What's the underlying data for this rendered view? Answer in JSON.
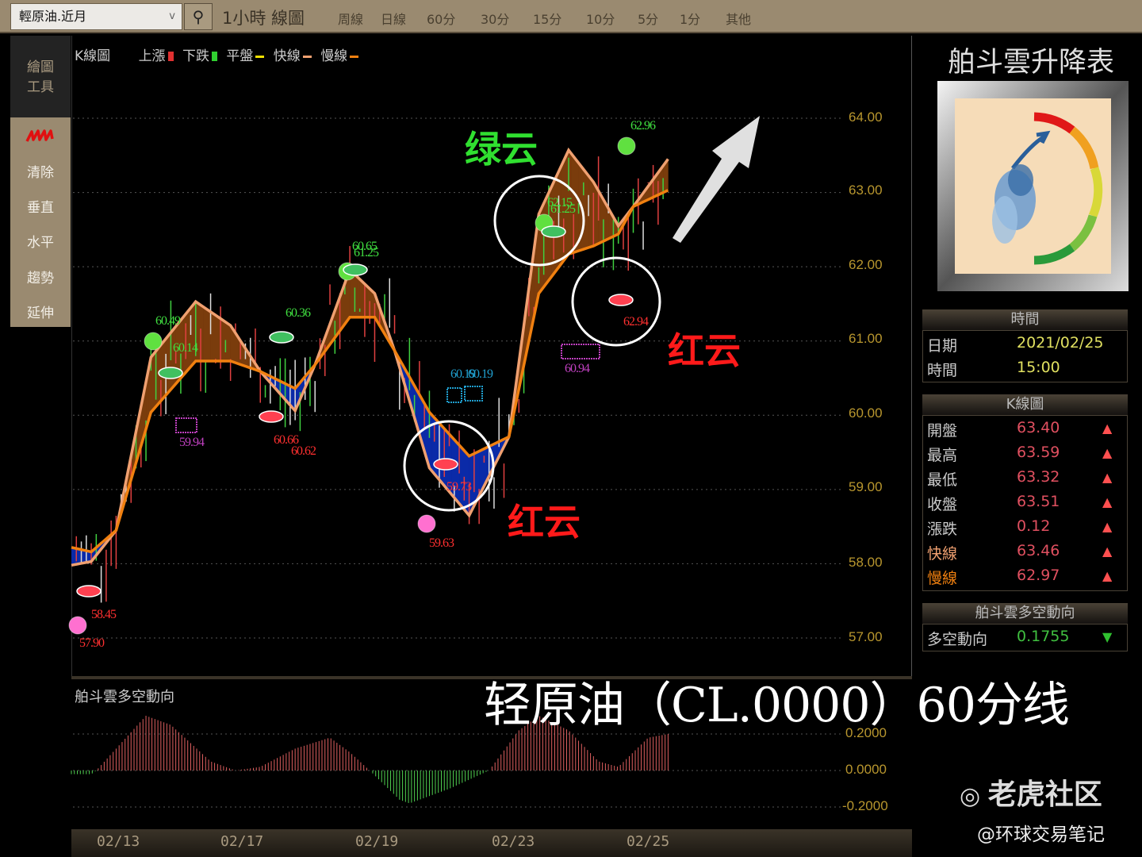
{
  "toolbar": {
    "symbol": "輕原油.近月",
    "chart_type": "1小時 線圖",
    "periods": [
      "周線",
      "日線",
      "60分",
      "30分",
      "15分",
      "10分",
      "5分",
      "1分",
      "其他"
    ]
  },
  "sidebar": {
    "header": [
      "繪圖",
      "工具"
    ],
    "tools": [
      "清除",
      "垂直",
      "水平",
      "趨勢",
      "延伸"
    ],
    "pen_icon": "scribble-icon"
  },
  "legend": {
    "title": "K線圖",
    "items": [
      {
        "label": "上漲",
        "color": "#e03030"
      },
      {
        "label": "下跌",
        "color": "#30d030"
      },
      {
        "label": "平盤",
        "color": "#f0e000"
      },
      {
        "label": "快線",
        "color": "#f0a070"
      },
      {
        "label": "慢線",
        "color": "#f08010"
      }
    ]
  },
  "indicator": {
    "title": "舶斗雲多空動向"
  },
  "chart_data": [
    {
      "type": "line",
      "title": "K線圖",
      "y_ticks": [
        "64.00",
        "63.00",
        "62.00",
        "61.00",
        "60.00",
        "59.00",
        "58.00",
        "57.00"
      ],
      "ylim": [
        57.0,
        64.0
      ],
      "x_ticks": [
        "02/13",
        "02/17",
        "02/19",
        "02/23",
        "02/25"
      ],
      "grid": true,
      "series": [
        {
          "name": "快線",
          "color": "#f0a070",
          "points": [
            [
              0,
              57.98
            ],
            [
              4,
              58.03
            ],
            [
              9,
              58.45
            ],
            [
              16,
              60.78
            ],
            [
              25,
              61.53
            ],
            [
              32,
              61.21
            ],
            [
              38,
              60.59
            ],
            [
              45,
              60.06
            ],
            [
              49,
              60.68
            ],
            [
              56,
              61.96
            ],
            [
              61,
              61.64
            ],
            [
              65,
              60.87
            ],
            [
              72,
              59.29
            ],
            [
              80,
              58.65
            ],
            [
              88,
              59.71
            ],
            [
              94,
              62.71
            ],
            [
              100,
              63.57
            ],
            [
              105,
              63.14
            ],
            [
              110,
              62.55
            ],
            [
              113,
              62.81
            ],
            [
              120,
              63.45
            ]
          ]
        },
        {
          "name": "慢線",
          "color": "#f08010",
          "points": [
            [
              0,
              58.22
            ],
            [
              4,
              58.16
            ],
            [
              9,
              58.45
            ],
            [
              16,
              60.04
            ],
            [
              25,
              60.73
            ],
            [
              32,
              60.73
            ],
            [
              38,
              60.59
            ],
            [
              45,
              60.36
            ],
            [
              49,
              60.68
            ],
            [
              56,
              61.32
            ],
            [
              61,
              61.32
            ],
            [
              65,
              60.87
            ],
            [
              72,
              60.04
            ],
            [
              80,
              59.45
            ],
            [
              88,
              59.71
            ],
            [
              94,
              61.64
            ],
            [
              100,
              62.17
            ],
            [
              105,
              62.28
            ],
            [
              110,
              62.44
            ],
            [
              113,
              62.81
            ],
            [
              120,
              63.03
            ]
          ]
        }
      ],
      "cloud_colors": {
        "bull": "#7a3c0c",
        "bear": "#0a2aa8"
      },
      "annotations": [
        {
          "text": "57.90",
          "color": "#ff3030"
        },
        {
          "text": "58.45",
          "color": "#ff3030"
        },
        {
          "text": "60.49",
          "color": "#40e040"
        },
        {
          "text": "60.14",
          "color": "#40e040"
        },
        {
          "text": "59.94",
          "color": "#c040c0"
        },
        {
          "text": "60.36",
          "color": "#40e040"
        },
        {
          "text": "60.66",
          "color": "#ff3030"
        },
        {
          "text": "60.62",
          "color": "#ff3030"
        },
        {
          "text": "60.65",
          "color": "#40e040"
        },
        {
          "text": "61.25",
          "color": "#40e040"
        },
        {
          "text": "60.19",
          "color": "#20a0d0"
        },
        {
          "text": "60.19",
          "color": "#20a0d0"
        },
        {
          "text": "59.73",
          "color": "#ff3030"
        },
        {
          "text": "59.63",
          "color": "#ff3030"
        },
        {
          "text": "62.15",
          "color": "#40e040"
        },
        {
          "text": "61.25",
          "color": "#40e040"
        },
        {
          "text": "62.94",
          "color": "#ff3030"
        },
        {
          "text": "60.94",
          "color": "#c040c0"
        },
        {
          "text": "62.96",
          "color": "#40e040"
        }
      ]
    },
    {
      "type": "bar",
      "title": "舶斗雲多空動向",
      "y_ticks": [
        "0.2000",
        "0.0000",
        "-0.2000"
      ],
      "ylim": [
        -0.25,
        0.35
      ],
      "colors": {
        "positive": "#e06060",
        "negative": "#50d050"
      },
      "keypoints": [
        [
          0,
          -0.02
        ],
        [
          4,
          -0.02
        ],
        [
          5,
          0
        ],
        [
          10,
          0.15
        ],
        [
          15,
          0.3
        ],
        [
          20,
          0.25
        ],
        [
          28,
          0.05
        ],
        [
          33,
          0.0
        ],
        [
          38,
          0.02
        ],
        [
          45,
          0.12
        ],
        [
          52,
          0.18
        ],
        [
          56,
          0.1
        ],
        [
          60,
          0.0
        ],
        [
          66,
          -0.16
        ],
        [
          68,
          -0.18
        ],
        [
          76,
          -0.1
        ],
        [
          84,
          0
        ],
        [
          90,
          0.22
        ],
        [
          94,
          0.3
        ],
        [
          100,
          0.22
        ],
        [
          106,
          0.05
        ],
        [
          110,
          0.02
        ],
        [
          116,
          0.18
        ],
        [
          120,
          0.2
        ]
      ]
    }
  ],
  "overlay": {
    "green_cloud": "绿云",
    "red_cloud_1": "红云",
    "red_cloud_2": "红云",
    "caption": "轻原油（CL.0000）60分线"
  },
  "right_panel": {
    "title": "舶斗雲升降表",
    "time_section": {
      "header": "時間",
      "rows": [
        {
          "label": "日期",
          "value": "2021/02/25"
        },
        {
          "label": "時間",
          "value": "15:00"
        }
      ]
    },
    "k_section": {
      "header": "K線圖",
      "rows": [
        {
          "label": "開盤",
          "value": "63.40",
          "trend": "▲"
        },
        {
          "label": "最高",
          "value": "63.59",
          "trend": "▲"
        },
        {
          "label": "最低",
          "value": "63.32",
          "trend": "▲"
        },
        {
          "label": "收盤",
          "value": "63.51",
          "trend": "▲"
        },
        {
          "label": "漲跌",
          "value": "0.12",
          "trend": "▲"
        },
        {
          "label": "快線",
          "value": "63.46",
          "trend": "▲"
        },
        {
          "label": "慢線",
          "value": "62.97",
          "trend": "▲"
        }
      ]
    },
    "direction_section": {
      "header": "舶斗雲多空動向",
      "rows": [
        {
          "label": "多空動向",
          "value": "0.1755",
          "trend": "▼"
        }
      ]
    }
  },
  "watermark": {
    "logo": "老虎社区",
    "user": "@环球交易笔记"
  }
}
